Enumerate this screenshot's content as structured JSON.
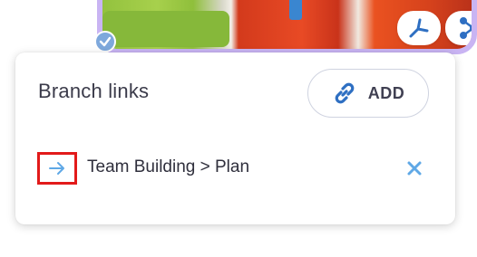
{
  "card": {
    "branch_count": "1"
  },
  "panel": {
    "title": "Branch links",
    "add_label": "ADD"
  },
  "links": [
    {
      "label": "Team Building > Plan"
    }
  ],
  "colors": {
    "accent_blue": "#4a90e2",
    "arrow_blue": "#5fa8e6",
    "highlight_red": "#e21a1a",
    "card_border": "#c9b4f3"
  },
  "icons": {
    "add": "link-icon",
    "row": "arrow-right-icon",
    "remove": "close-icon"
  }
}
